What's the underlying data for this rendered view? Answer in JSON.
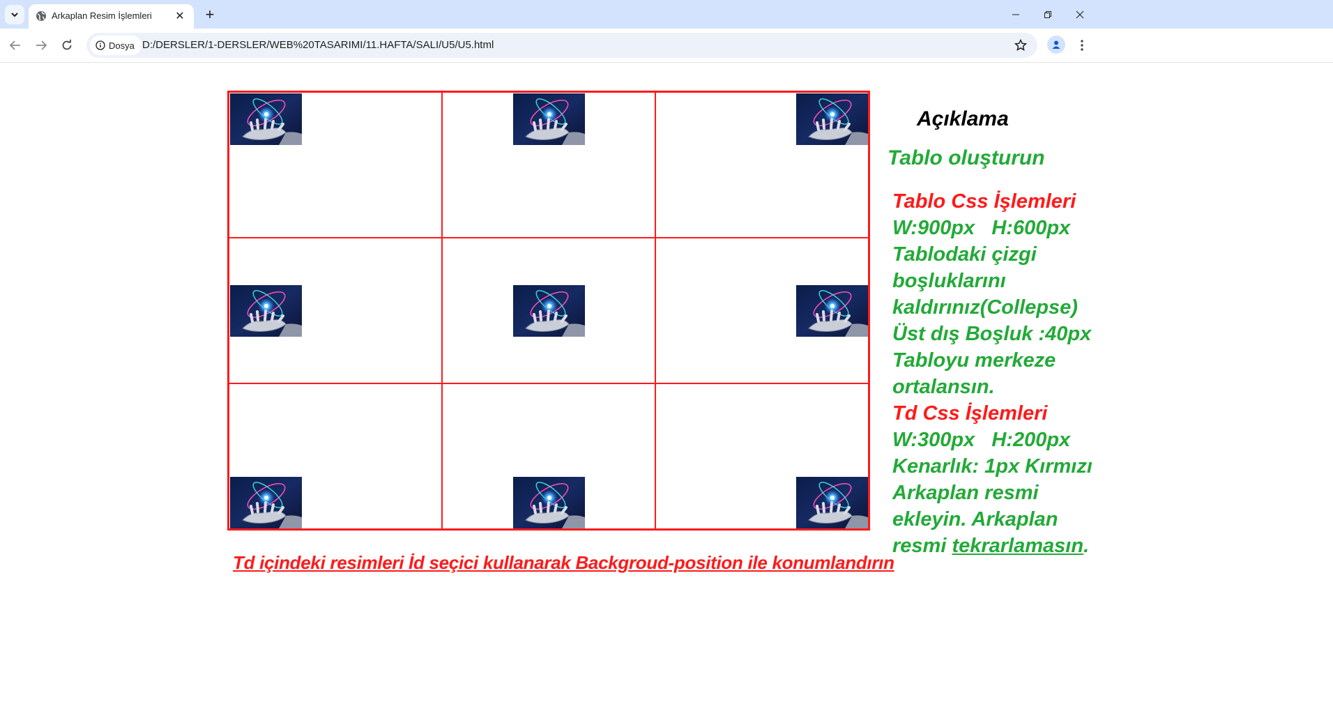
{
  "browser": {
    "tab_title": "Arkaplan Resim İşlemleri",
    "site_chip": "Dosya",
    "url": "D:/DERSLER/1-DERSLER/WEB%20TASARIMI/11.HAFTA/SALI/U5/U5.html",
    "icons": [
      "tab-list-icon",
      "globe-icon",
      "close-icon",
      "plus-icon",
      "minimize-icon",
      "restore-icon",
      "close-window-icon",
      "back-icon",
      "forward-icon",
      "reload-icon",
      "info-icon",
      "star-icon",
      "profile-icon",
      "kebab-menu-icon"
    ]
  },
  "page": {
    "grid": {
      "border_color": "#ff1a1a",
      "cells": [
        {
          "position": "left top"
        },
        {
          "position": "center top"
        },
        {
          "position": "right top"
        },
        {
          "position": "left center"
        },
        {
          "position": "center center"
        },
        {
          "position": "right center"
        },
        {
          "position": "left bottom"
        },
        {
          "position": "center bottom"
        },
        {
          "position": "right bottom"
        }
      ]
    },
    "bottom_note": "Td içindeki resimleri İd seçici kullanarak Backgroud-position ile konumlandırın",
    "aside": {
      "title": "Açıklama",
      "subtitle": "Tablo oluşturun",
      "table_heading": "Tablo Css İşlemleri",
      "table_size": "W:900px   H:600px",
      "collapse_1": "Tablodaki çizgi",
      "collapse_2": "boşluklarını",
      "collapse_3": "kaldırınız(Collepse)",
      "margin": "Üst dış Boşluk :40px",
      "center_1": "Tabloyu merkeze",
      "center_2": "ortalansın.",
      "td_heading": "Td Css İşlemleri",
      "td_size": "W:300px   H:200px",
      "border": "Kenarlık: 1px Kırmızı",
      "bg_1": "Arkaplan resmi",
      "bg_2": "ekleyin. Arkaplan",
      "bg_3_prefix": "resmi ",
      "bg_3_link": "tekrarlamasın",
      "bg_3_suffix": "."
    },
    "colors": {
      "green": "#22aa37",
      "red": "#ff1a1a",
      "chrome": "#d3e3fd"
    }
  }
}
